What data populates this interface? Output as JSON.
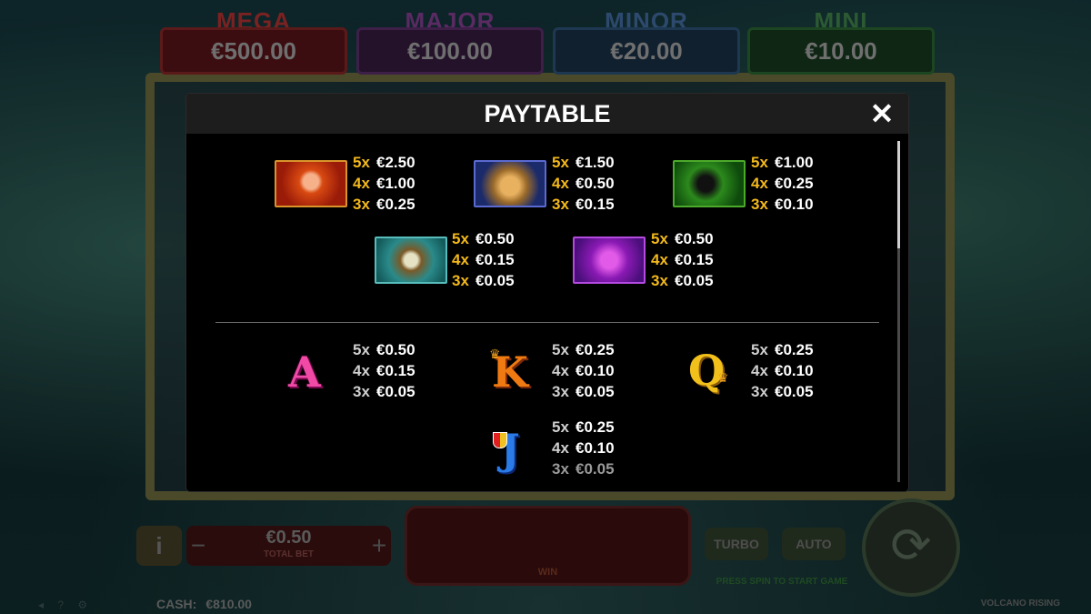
{
  "jackpots": [
    {
      "name": "MEGA",
      "value": "€500.00"
    },
    {
      "name": "MAJOR",
      "value": "€100.00"
    },
    {
      "name": "MINOR",
      "value": "€20.00"
    },
    {
      "name": "MINI",
      "value": "€10.00"
    }
  ],
  "paytable": {
    "title": "PAYTABLE",
    "close_symbol": "✕",
    "high_symbols": [
      {
        "symbol": "goddess",
        "pays": [
          {
            "count": "5x",
            "amount": "€2.50"
          },
          {
            "count": "4x",
            "amount": "€1.00"
          },
          {
            "count": "3x",
            "amount": "€0.25"
          }
        ]
      },
      {
        "symbol": "jaguar",
        "pays": [
          {
            "count": "5x",
            "amount": "€1.50"
          },
          {
            "count": "4x",
            "amount": "€0.50"
          },
          {
            "count": "3x",
            "amount": "€0.15"
          }
        ]
      },
      {
        "symbol": "toucan",
        "pays": [
          {
            "count": "5x",
            "amount": "€1.00"
          },
          {
            "count": "4x",
            "amount": "€0.25"
          },
          {
            "count": "3x",
            "amount": "€0.10"
          }
        ]
      },
      {
        "symbol": "drum",
        "pays": [
          {
            "count": "5x",
            "amount": "€0.50"
          },
          {
            "count": "4x",
            "amount": "€0.15"
          },
          {
            "count": "3x",
            "amount": "€0.05"
          }
        ]
      },
      {
        "symbol": "orchid",
        "pays": [
          {
            "count": "5x",
            "amount": "€0.50"
          },
          {
            "count": "4x",
            "amount": "€0.15"
          },
          {
            "count": "3x",
            "amount": "€0.05"
          }
        ]
      }
    ],
    "low_symbols": [
      {
        "symbol": "A",
        "pays": [
          {
            "count": "5x",
            "amount": "€0.50"
          },
          {
            "count": "4x",
            "amount": "€0.15"
          },
          {
            "count": "3x",
            "amount": "€0.05"
          }
        ]
      },
      {
        "symbol": "K",
        "pays": [
          {
            "count": "5x",
            "amount": "€0.25"
          },
          {
            "count": "4x",
            "amount": "€0.10"
          },
          {
            "count": "3x",
            "amount": "€0.05"
          }
        ]
      },
      {
        "symbol": "Q",
        "pays": [
          {
            "count": "5x",
            "amount": "€0.25"
          },
          {
            "count": "4x",
            "amount": "€0.10"
          },
          {
            "count": "3x",
            "amount": "€0.05"
          }
        ]
      },
      {
        "symbol": "J",
        "pays": [
          {
            "count": "5x",
            "amount": "€0.25"
          },
          {
            "count": "4x",
            "amount": "€0.10"
          },
          {
            "count": "3x",
            "amount": "€0.05"
          }
        ]
      }
    ],
    "scroll_position": 0.0
  },
  "controls": {
    "info_label": "i",
    "bet_minus": "−",
    "bet_plus": "+",
    "bet_value": "€0.50",
    "bet_label": "TOTAL BET",
    "win_label": "WIN",
    "turbo_label": "TURBO",
    "auto_label": "AUTO",
    "status_text": "PRESS SPIN TO START GAME",
    "spin_icon": "⟳"
  },
  "footer": {
    "cash_label": "CASH:",
    "cash_value": "€810.00",
    "game_name": "VOLCANO RISING"
  },
  "colors": {
    "multiplier_high": "#f2b81c",
    "multiplier_low": "#cfcfcf",
    "modal_bg": "#000000",
    "header_bg": "#1d1d1d"
  }
}
